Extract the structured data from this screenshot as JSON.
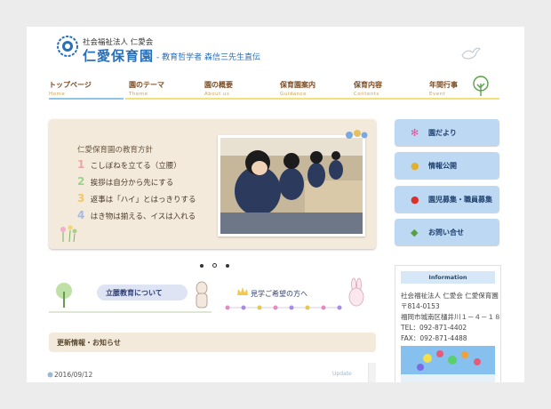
{
  "header": {
    "org_small": "社会福祉法人 仁愛会",
    "org_name": "仁愛保育園",
    "org_sub": "- 教育哲学者 森信三先生直伝"
  },
  "nav": [
    {
      "jp": "トップページ",
      "en": "Home",
      "color": "#8fc6e8"
    },
    {
      "jp": "園のテーマ",
      "en": "Theme",
      "color": "#f2e07a"
    },
    {
      "jp": "園の概要",
      "en": "About us",
      "color": "#f2e07a"
    },
    {
      "jp": "保育園案内",
      "en": "Guidance",
      "color": "#f2e07a"
    },
    {
      "jp": "保育内容",
      "en": "Contents",
      "color": "#f2e07a"
    },
    {
      "jp": "年間行事",
      "en": "Event",
      "color": "#f2e07a"
    }
  ],
  "slider": {
    "title": "仁愛保育園の教育方針",
    "tenets": [
      {
        "num": "1",
        "text": "こしぼねを立てる（立腰）",
        "color": "#e8a6a6"
      },
      {
        "num": "2",
        "text": "挨拶は自分から先にする",
        "color": "#9ed28a"
      },
      {
        "num": "3",
        "text": "返事は「ハイ」とはっきりする",
        "color": "#f2c56a"
      },
      {
        "num": "4",
        "text": "はき物は揃える、イスは入れる",
        "color": "#a7b9e8"
      }
    ]
  },
  "side_buttons": [
    {
      "label": "園だより",
      "icon": "flower-icon",
      "glyph": "✻",
      "color": "#d65aa0"
    },
    {
      "label": "情報公開",
      "icon": "bee-icon",
      "glyph": "●",
      "color": "#e0b030"
    },
    {
      "label": "園児募集・職員募集",
      "icon": "ladybug-icon",
      "glyph": "●",
      "color": "#d8322a"
    },
    {
      "label": "お問い合せ",
      "icon": "leaf-icon",
      "glyph": "◆",
      "color": "#5aa040"
    }
  ],
  "banners": {
    "ritsuyo": "立腰教育について",
    "visit": "見学ご希望の方へ"
  },
  "info": {
    "heading": "Information",
    "lines": [
      "社会福祉法人 仁愛会 仁愛保育園",
      "〒814-0153",
      "福岡市城南区樋井川１－４－１８",
      "TEL：092-871-4402",
      "FAX：092-871-4488"
    ]
  },
  "news": {
    "heading": "更新情報・お知らせ",
    "date": "2016/09/12",
    "tag": "Update"
  }
}
